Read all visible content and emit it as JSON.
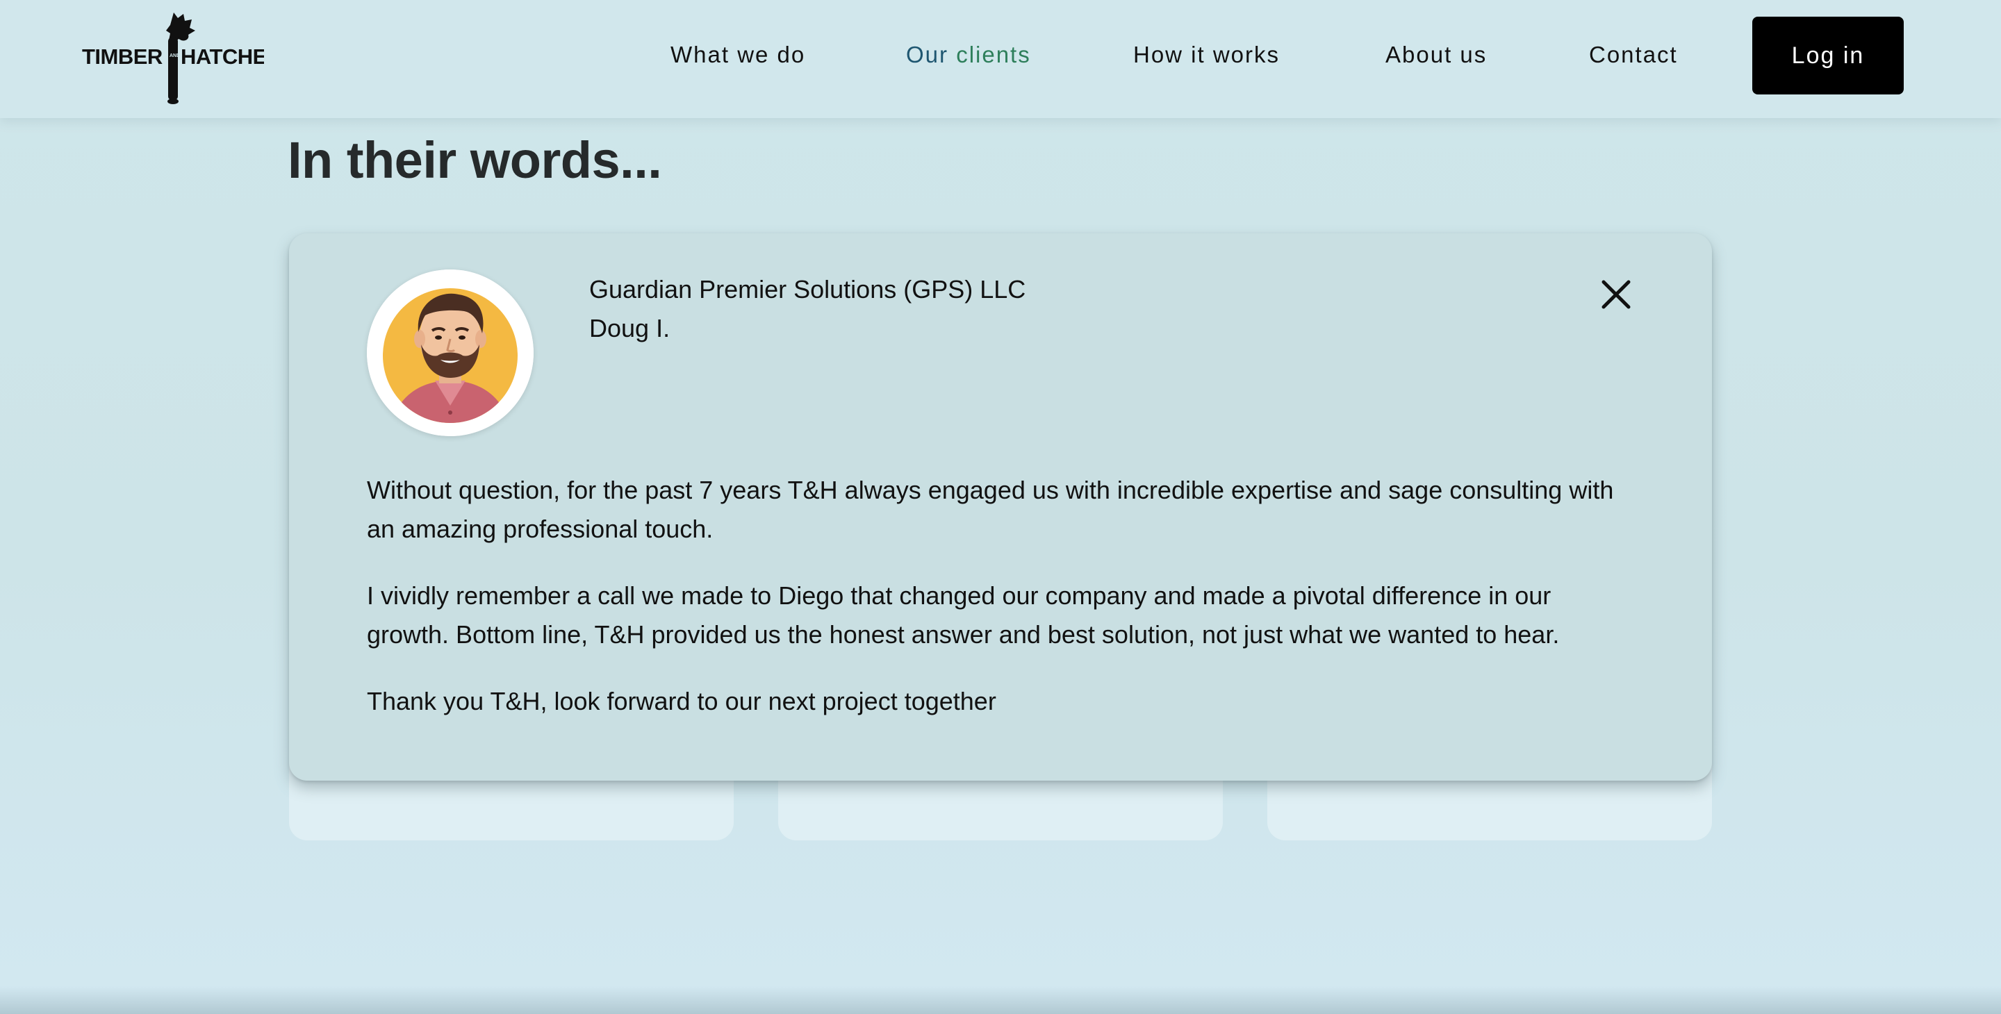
{
  "header": {
    "logo": {
      "left_word": "TIMBER",
      "middle_word": "AND",
      "right_word": "HATCHET",
      "icon": "hatchet-icon"
    },
    "nav": [
      {
        "label": "What we do",
        "active": false
      },
      {
        "label": "Our clients",
        "active": true
      },
      {
        "label": "How it works",
        "active": false
      },
      {
        "label": "About us",
        "active": false
      },
      {
        "label": "Contact",
        "active": false
      }
    ],
    "login_label": "Log in"
  },
  "section": {
    "title": "In their words..."
  },
  "testimonial": {
    "company": "Guardian Premier Solutions (GPS) LLC",
    "person": "Doug I.",
    "avatar_icon": "avatar-illustration",
    "close_icon": "close-icon",
    "paragraphs": [
      "Without question, for the past 7 years T&H always engaged us with incredible expertise and sage consulting with an amazing professional touch.",
      "I vividly remember a call we made to Diego that changed our company and made a pivotal difference in our growth. Bottom line, T&H provided us the honest answer and best solution, not just what we wanted to hear.",
      "Thank you T&H, look forward to our next project together"
    ]
  },
  "colors": {
    "background": "#cfe6ea",
    "modal": "#c9dfe2",
    "login_button": "#000000",
    "active_nav": "#1e5670",
    "active_nav_accent": "#2e7f5b",
    "avatar_bg": "#f4b942",
    "shirt": "#c9636f"
  }
}
